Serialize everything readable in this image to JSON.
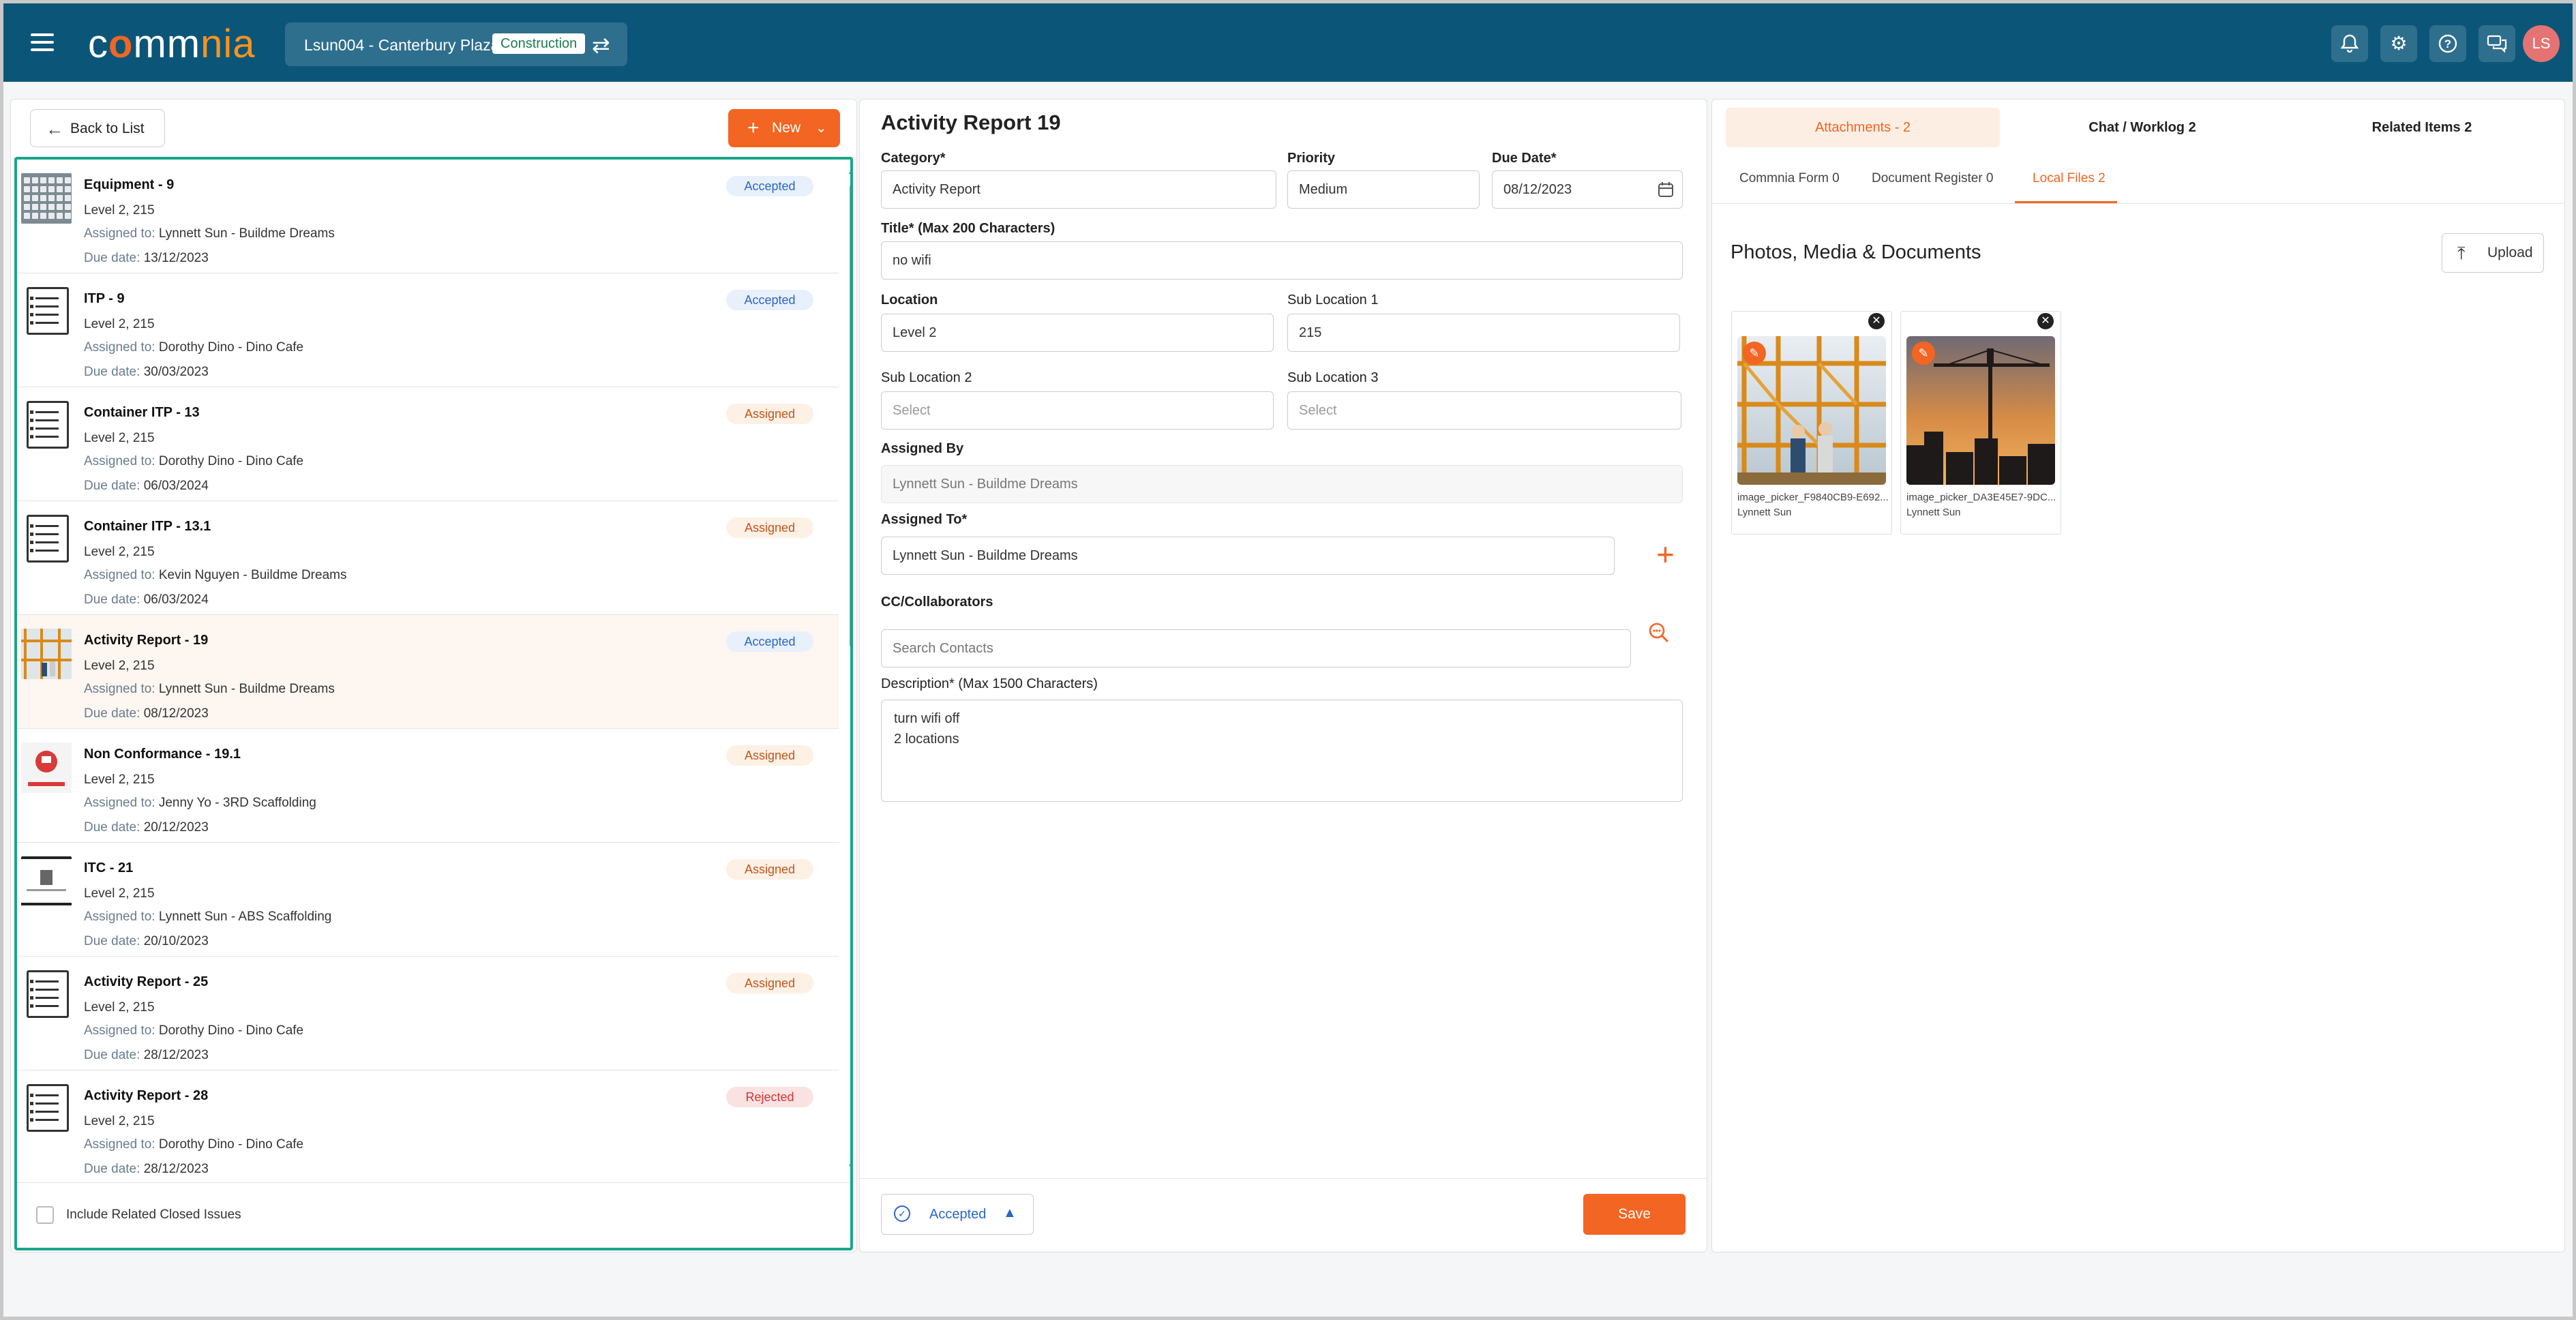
{
  "topbar": {
    "logo": {
      "c": "c",
      "o": "o",
      "mm": "mm",
      "nia": "nia"
    },
    "project_name": "Lsun004 - Canterbury Plaza",
    "project_tag": "Construction",
    "avatar_initials": "LS",
    "brand_color": "#0b5678",
    "accent_color": "#f26522"
  },
  "left": {
    "back_label": "Back to List",
    "new_label": "New",
    "assigned_to_label": "Assigned to:",
    "due_date_label": "Due date:",
    "items": [
      {
        "title": "Equipment - 9",
        "location": "Level 2, 215",
        "assigned": "Lynnett Sun - Buildme Dreams",
        "due": "13/12/2023",
        "status": "Accepted",
        "thumb": "keyboard-photo"
      },
      {
        "title": "ITP - 9",
        "location": "Level 2, 215",
        "assigned": "Dorothy Dino - Dino Cafe",
        "due": "30/03/2023",
        "status": "Accepted",
        "thumb": "document-icon"
      },
      {
        "title": "Container ITP - 13",
        "location": "Level 2, 215",
        "assigned": "Dorothy Dino - Dino Cafe",
        "due": "06/03/2024",
        "status": "Assigned",
        "thumb": "document-icon"
      },
      {
        "title": "Container ITP - 13.1",
        "location": "Level 2, 215",
        "assigned": "Kevin Nguyen - Buildme Dreams",
        "due": "06/03/2024",
        "status": "Assigned",
        "thumb": "document-icon"
      },
      {
        "title": "Activity Report - 19",
        "location": "Level 2, 215",
        "assigned": "Lynnett Sun - Buildme Dreams",
        "due": "08/12/2023",
        "status": "Accepted",
        "thumb": "scaffold-photo"
      },
      {
        "title": "Non Conformance - 19.1",
        "location": "Level 2, 215",
        "assigned": "Jenny Yo - 3RD Scaffolding",
        "due": "20/12/2023",
        "status": "Assigned",
        "thumb": "nc-photo"
      },
      {
        "title": "ITC - 21",
        "location": "Level 2, 215",
        "assigned": "Lynnett Sun - ABS Scaffolding",
        "due": "20/10/2023",
        "status": "Assigned",
        "thumb": "itc-photo"
      },
      {
        "title": "Activity Report - 25",
        "location": "Level 2, 215",
        "assigned": "Dorothy Dino - Dino Cafe",
        "due": "28/12/2023",
        "status": "Assigned",
        "thumb": "document-icon"
      },
      {
        "title": "Activity Report - 28",
        "location": "Level 2, 215",
        "assigned": "Dorothy Dino - Dino Cafe",
        "due": "28/12/2023",
        "status": "Rejected",
        "thumb": "document-icon"
      }
    ],
    "include_closed_label": "Include Related Closed Issues"
  },
  "form": {
    "title": "Activity Report 19",
    "category_label": "Category*",
    "category_value": "Activity Report",
    "priority_label": "Priority",
    "priority_value": "Medium",
    "due_label": "Due Date*",
    "due_value": "08/12/2023",
    "title_label": "Title* (Max 200 Characters)",
    "title_value": "no wifi",
    "location_label": "Location",
    "location_value": "Level 2",
    "sub1_label": "Sub Location 1",
    "sub1_value": "215",
    "sub2_label": "Sub Location 2",
    "sub2_placeholder": "Select",
    "sub3_label": "Sub Location 3",
    "sub3_placeholder": "Select",
    "assigned_by_label": "Assigned By",
    "assigned_by_value": "Lynnett Sun - Buildme Dreams",
    "assigned_to_label": "Assigned To*",
    "assigned_to_value": "Lynnett Sun - Buildme Dreams",
    "cc_label": "CC/Collaborators",
    "cc_placeholder": "Search Contacts",
    "desc_label": "Description* (Max 1500 Characters)",
    "desc_value": "turn wifi off\n2 locations",
    "status": "Accepted",
    "save_label": "Save"
  },
  "right": {
    "tabs": [
      "Attachments - 2",
      "Chat / Worklog 2",
      "Related Items 2"
    ],
    "subtabs": [
      "Commnia Form 0",
      "Document Register 0",
      "Local Files 2"
    ],
    "section_title": "Photos, Media & Documents",
    "upload_label": "Upload",
    "files": [
      {
        "name": "image_picker_F9840CB9-E692...",
        "owner": "Lynnett Sun"
      },
      {
        "name": "image_picker_DA3E45E7-9DC...",
        "owner": "Lynnett Sun"
      }
    ]
  }
}
